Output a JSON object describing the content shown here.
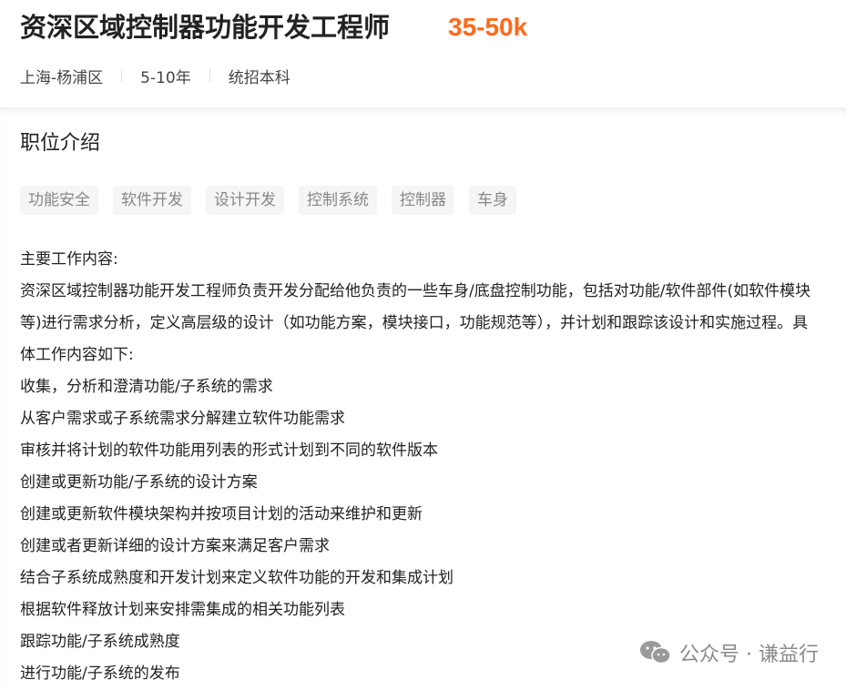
{
  "job": {
    "title": "资深区域控制器功能开发工程师",
    "salary": "35-50k",
    "location": "上海-杨浦区",
    "experience": "5-10年",
    "education": "统招本科"
  },
  "section": {
    "title": "职位介绍",
    "tags": [
      "功能安全",
      "软件开发",
      "设计开发",
      "控制系统",
      "控制器",
      "车身"
    ],
    "description_lines": [
      "主要工作内容:",
      "资深区域控制器功能开发工程师负责开发分配给他负责的一些车身/底盘控制功能，包括对功能/软件部件(如软件模块",
      "等)进行需求分析，定义高层级的设计（如功能方案，模块接口，功能规范等），并计划和跟踪该设计和实施过程。具",
      "体工作内容如下:",
      "收集，分析和澄清功能/子系统的需求",
      "从客户需求或子系统需求分解建立软件功能需求",
      "审核并将计划的软件功能用列表的形式计划到不同的软件版本",
      "创建或更新功能/子系统的设计方案",
      "创建或更新软件模块架构并按项目计划的活动来维护和更新",
      "创建或者更新详细的设计方案来满足客户需求",
      "结合子系统成熟度和开发计划来定义软件功能的开发和集成计划",
      "根据软件释放计划来安排需集成的相关功能列表",
      "跟踪功能/子系统成熟度",
      "进行功能/子系统的发布"
    ]
  },
  "watermark": {
    "text": "公众号 · 谦益行",
    "icon": "wechat-icon"
  },
  "colors": {
    "salary": "#fe6a1b",
    "tag_bg": "#f5f5f5",
    "tag_text": "#888888"
  }
}
